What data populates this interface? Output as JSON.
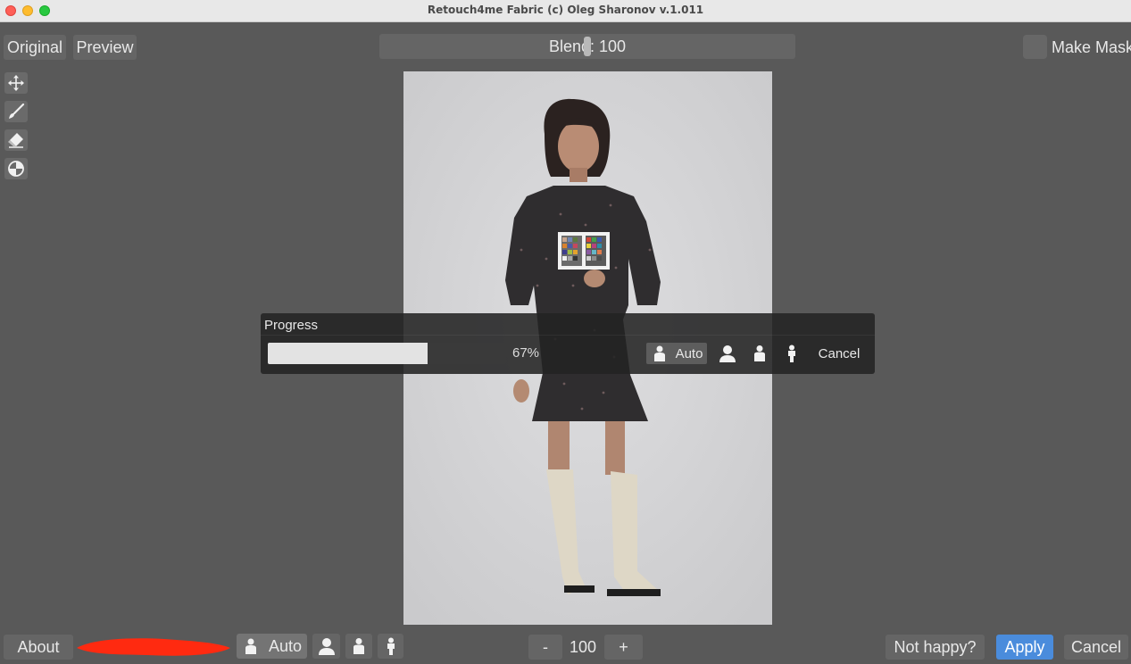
{
  "window": {
    "title": "Retouch4me Fabric (c) Oleg Sharonov v.1.011"
  },
  "toolbar": {
    "original_label": "Original",
    "preview_label": "Preview",
    "blend_label": "Blend: 100",
    "make_mask_label": "Make Mask",
    "make_mask_checked": false
  },
  "tools": [
    "move-icon",
    "brush-icon",
    "eraser-icon",
    "fill-icon"
  ],
  "progress": {
    "title": "Progress",
    "percent_text": "67%",
    "value": 0.67,
    "auto_label": "Auto",
    "cancel_label": "Cancel"
  },
  "bottom": {
    "about_label": "About",
    "auto_label": "Auto",
    "minus_label": "-",
    "zoom_value": "100",
    "plus_label": "+",
    "not_happy_label": "Not happy?",
    "apply_label": "Apply",
    "cancel_label": "Cancel"
  },
  "colors": {
    "background": "#595959",
    "button": "#656565",
    "accent": "#4a8cdc",
    "redaction": "#ff2a10"
  }
}
